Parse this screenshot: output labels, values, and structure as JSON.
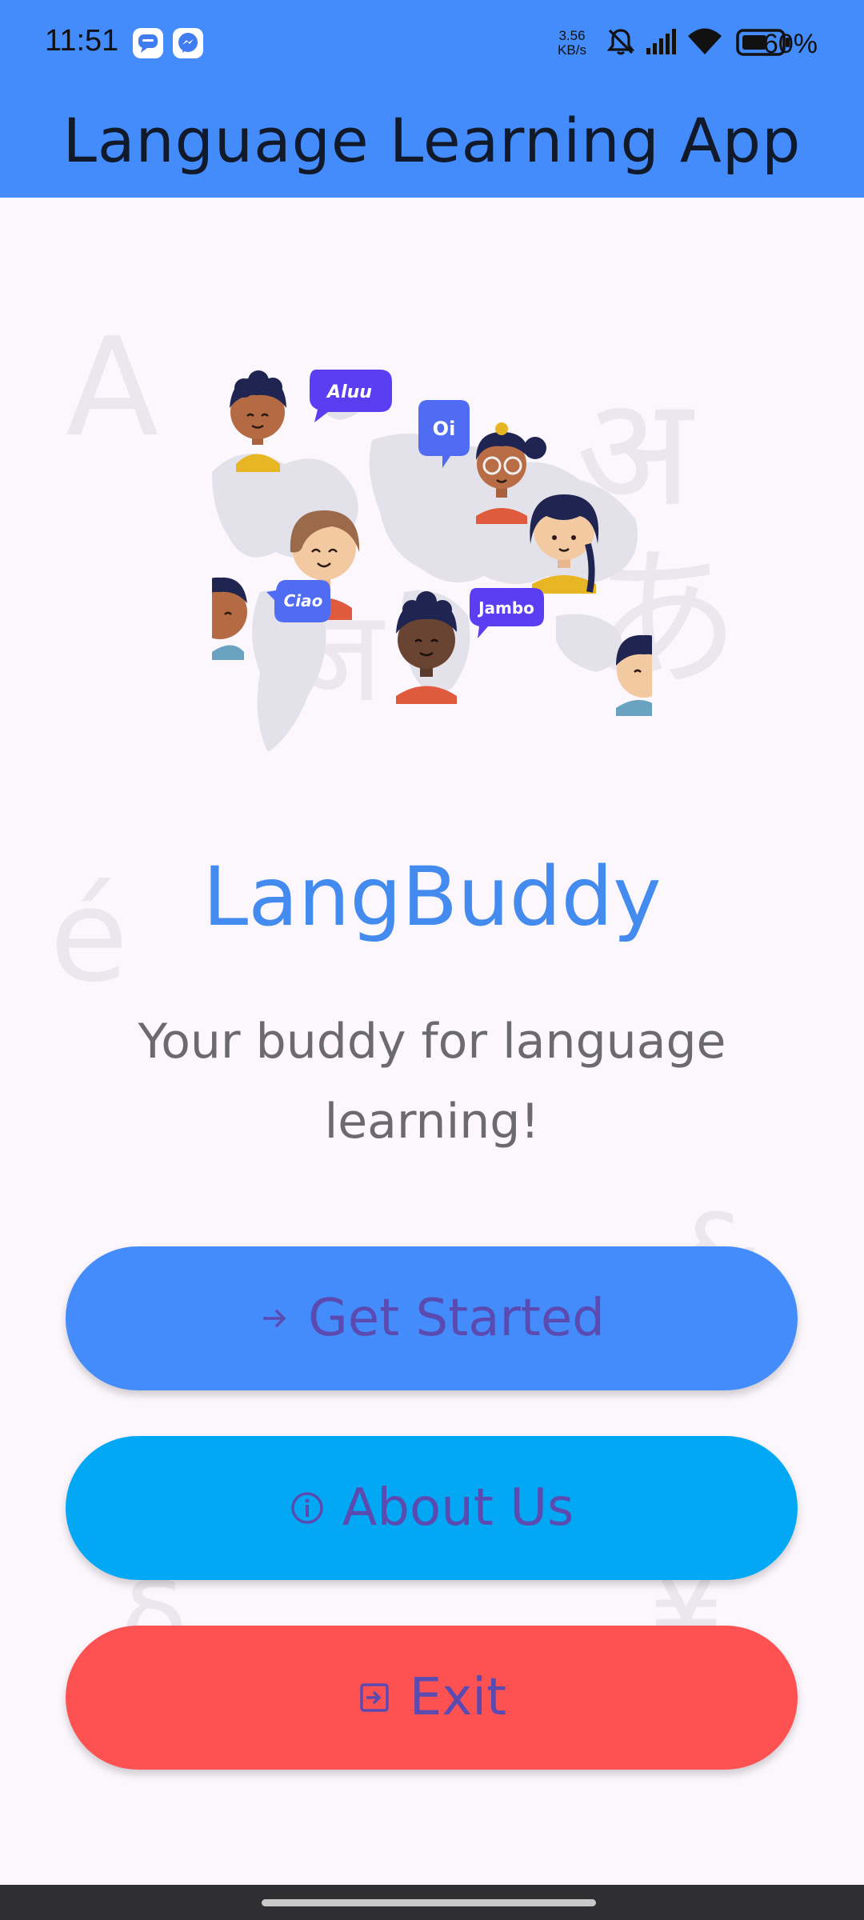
{
  "status_bar": {
    "time": "11:51",
    "net_speed_value": "3.56",
    "net_speed_unit": "KB/s",
    "battery_percent": "60%",
    "icons": [
      "messages-app-icon",
      "messenger-app-icon",
      "bell-muted-icon",
      "cellular-signal-icon",
      "wifi-icon",
      "battery-icon"
    ]
  },
  "header": {
    "title": "Language Learning App"
  },
  "background_letters": [
    "A",
    "अ",
    "あ",
    "é",
    "ज",
    "&",
    "¥",
    "δ"
  ],
  "illustration": {
    "bubbles": [
      "Aluu",
      "Oi",
      "Ciao",
      "Jambo"
    ]
  },
  "brand": {
    "name": "LangBuddy",
    "tagline": "Your buddy for language learning!"
  },
  "buttons": {
    "get_started": {
      "label": "Get Started",
      "icon": "arrow-right-icon"
    },
    "about_us": {
      "label": "About Us",
      "icon": "info-icon"
    },
    "exit": {
      "label": "Exit",
      "icon": "exit-icon"
    }
  },
  "colors": {
    "appbar": "#448bfb",
    "brand_text": "#448bf0",
    "get_started_bg": "#448bfb",
    "about_bg": "#03a8f4",
    "exit_bg": "#fe5252",
    "button_text": "#5b4bb0",
    "background": "#fcf7fd"
  }
}
